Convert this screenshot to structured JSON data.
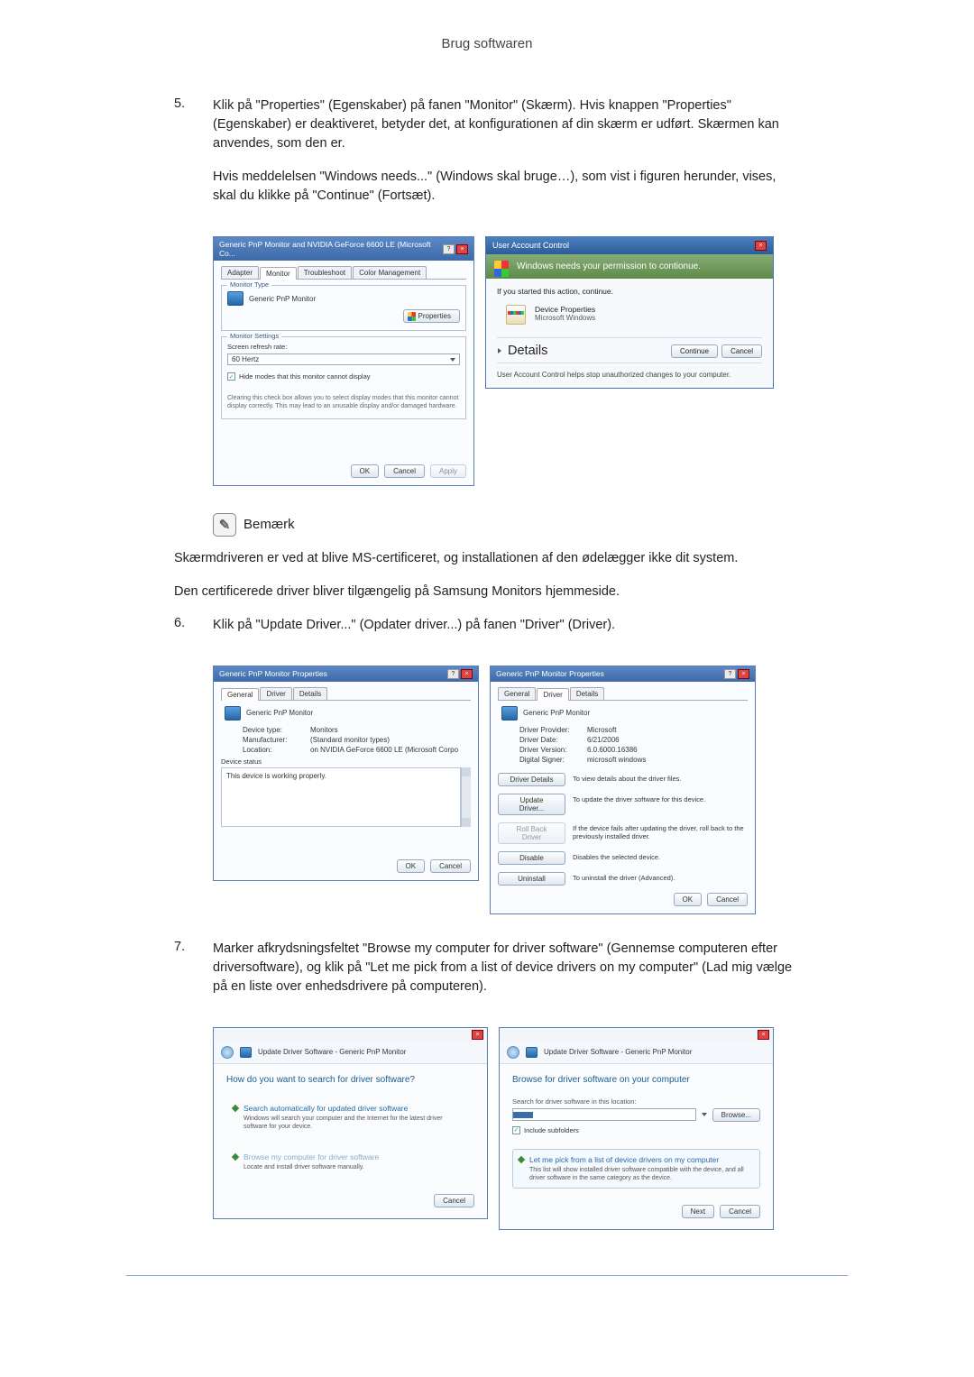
{
  "header": {
    "title": "Brug softwaren"
  },
  "step5": {
    "num": "5.",
    "p1": "Klik på \"Properties\" (Egenskaber) på fanen \"Monitor\" (Skærm). Hvis knappen \"Properties\" (Egenskaber) er deaktiveret, betyder det, at konfigurationen af din skærm er udført. Skærmen kan anvendes, som den er.",
    "p2": "Hvis meddelelsen \"Windows needs...\" (Windows skal bruge…), som vist i figuren herunder, vises, skal du klikke på \"Continue\" (Fortsæt)."
  },
  "monwin": {
    "title": "Generic PnP Monitor and NVIDIA GeForce 6600 LE (Microsoft Co...",
    "tabs": {
      "adapter": "Adapter",
      "monitor": "Monitor",
      "troubleshoot": "Troubleshoot",
      "colormgmt": "Color Management"
    },
    "grp_type": "Monitor Type",
    "monitor_name": "Generic PnP Monitor",
    "properties_btn": "Properties",
    "grp_settings": "Monitor Settings",
    "refresh_lab": "Screen refresh rate:",
    "refresh_val": "60 Hertz",
    "hide_modes": "Hide modes that this monitor cannot display",
    "hide_desc": "Clearing this check box allows you to select display modes that this monitor cannot display correctly. This may lead to an unusable display and/or damaged hardware.",
    "ok": "OK",
    "cancel": "Cancel",
    "apply": "Apply"
  },
  "uac": {
    "title": "User Account Control",
    "band": "Windows needs your permission to contionue.",
    "line1": "If you started this action, continue.",
    "app_name": "Device Properties",
    "app_pub": "Microsoft Windows",
    "details": "Details",
    "continue": "Continue",
    "cancel": "Cancel",
    "foot": "User Account Control helps stop unauthorized changes to your computer."
  },
  "note": {
    "heading": "Bemærk",
    "p1": "Skærmdriveren er ved at blive MS-certificeret, og installationen af den ødelægger ikke dit system.",
    "p2": "Den certificerede driver bliver tilgængelig på Samsung Monitors hjemmeside."
  },
  "step6": {
    "num": "6.",
    "p1": "Klik på \"Update Driver...\" (Opdater driver...) på fanen \"Driver\" (Driver)."
  },
  "propGen": {
    "title": "Generic PnP Monitor Properties",
    "tabs": {
      "general": "General",
      "driver": "Driver",
      "details": "Details"
    },
    "name": "Generic PnP Monitor",
    "k_type": "Device type:",
    "v_type": "Monitors",
    "k_mfr": "Manufacturer:",
    "v_mfr": "(Standard monitor types)",
    "k_loc": "Location:",
    "v_loc": "on NVIDIA GeForce 6600 LE (Microsoft Corpo",
    "status_lab": "Device status",
    "status_txt": "This device is working properly.",
    "ok": "OK",
    "cancel": "Cancel"
  },
  "propDrv": {
    "title": "Generic PnP Monitor Properties",
    "name": "Generic PnP Monitor",
    "k_prov": "Driver Provider:",
    "v_prov": "Microsoft",
    "k_date": "Driver Date:",
    "v_date": "6/21/2006",
    "k_ver": "Driver Version:",
    "v_ver": "6.0.6000.16386",
    "k_sign": "Digital Signer:",
    "v_sign": "microsoft windows",
    "b_details": "Driver Details",
    "d_details": "To view details about the driver files.",
    "b_update": "Update Driver...",
    "d_update": "To update the driver software for this device.",
    "b_roll": "Roll Back Driver",
    "d_roll": "If the device fails after updating the driver, roll back to the previously installed driver.",
    "b_disable": "Disable",
    "d_disable": "Disables the selected device.",
    "b_uninst": "Uninstall",
    "d_uninst": "To uninstall the driver (Advanced).",
    "ok": "OK",
    "cancel": "Cancel"
  },
  "step7": {
    "num": "7.",
    "p1": "Marker afkrydsningsfeltet \"Browse my computer for driver software\" (Gennemse computeren efter driversoftware), og klik på \"Let me pick from a list of device drivers on my computer\" (Lad mig vælge på en liste over enhedsdrivere på computeren)."
  },
  "wiz1": {
    "crumb": "Update Driver Software - Generic PnP Monitor",
    "q": "How do you want to search for driver software?",
    "opt1_t": "Search automatically for updated driver software",
    "opt1_d": "Windows will search your computer and the Internet for the latest driver software for your device.",
    "opt2_t": "Browse my computer for driver software",
    "opt2_d": "Locate and install driver software manually.",
    "cancel": "Cancel"
  },
  "wiz2": {
    "crumb": "Update Driver Software - Generic PnP Monitor",
    "q": "Browse for driver software on your computer",
    "loc_lab": "Search for driver software in this location:",
    "browse": "Browse...",
    "include": "Include subfolders",
    "opt_t": "Let me pick from a list of device drivers on my computer",
    "opt_d": "This list will show installed driver software compatible with the device, and all driver software in the same category as the device.",
    "next": "Next",
    "cancel": "Cancel"
  }
}
